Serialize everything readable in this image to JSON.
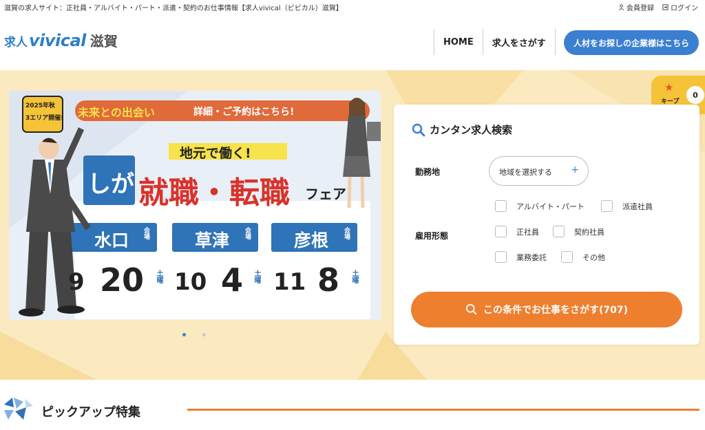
{
  "topbar": {
    "tagline": "滋賀の求人サイト：正社員・アルバイト・パート・派遣・契約のお仕事情報【求人vivical（ビビカル）滋賀】",
    "register": "会員登録",
    "login": "ログイン"
  },
  "header": {
    "logo_prefix": "求人",
    "logo_brand": "vivical",
    "logo_region": "滋賀",
    "nav": [
      "HOME",
      "求人をさがす"
    ],
    "corp_button": "人材をお探しの企業様はこちら"
  },
  "banner": {
    "badge_year": "2025年秋",
    "badge_area": "3エリア開催!",
    "ribbon_left": "未来との出会い",
    "ribbon_right": "詳細・ご予約はこちら!",
    "subtitle": "地元で働く!",
    "shiga": "しが",
    "title": "就職・転職",
    "fair": "フェア",
    "venues": [
      {
        "name": "水口",
        "tag": "会場",
        "date_month": "9",
        "date_day": "20",
        "weekday": "土曜"
      },
      {
        "name": "草津",
        "tag": "会場",
        "date_month": "10",
        "date_day": "4",
        "weekday": "土曜"
      },
      {
        "name": "彦根",
        "tag": "会場",
        "date_month": "11",
        "date_day": "8",
        "weekday": "土曜"
      }
    ]
  },
  "carousel": {
    "slides": 2,
    "active": 1
  },
  "keep": {
    "label": "キープ",
    "count": "0"
  },
  "search": {
    "title": "カンタン求人検索",
    "location_label": "勤務地",
    "location_placeholder": "地域を選択する",
    "plus": "+",
    "employment_label": "雇用形態",
    "options": [
      "アルバイト・パート",
      "派遣社員",
      "正社員",
      "契約社員",
      "業務委託",
      "その他"
    ],
    "submit": "この条件でお仕事をさがす(707)"
  },
  "pickup": {
    "title": "ピックアップ特集"
  },
  "colors": {
    "brand_blue": "#3b7fd1",
    "accent_orange": "#ee7f2f",
    "hero_bg": "#fbe9bf",
    "keep_yellow": "#f5c238",
    "banner_red": "#d9322a"
  }
}
